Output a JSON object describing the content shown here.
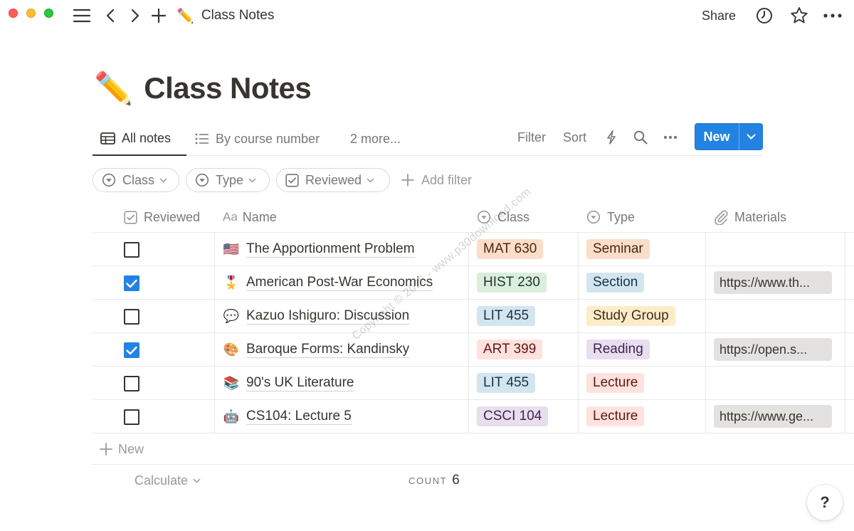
{
  "window": {
    "title_emoji": "✏️",
    "title": "Class Notes",
    "share_label": "Share"
  },
  "page": {
    "emoji": "✏️",
    "title": "Class Notes"
  },
  "views": {
    "tabs": [
      {
        "label": "All notes",
        "icon": "table-icon",
        "active": true
      },
      {
        "label": "By course number",
        "icon": "list-icon",
        "active": false
      }
    ],
    "more_label": "2 more...",
    "filter_label": "Filter",
    "sort_label": "Sort",
    "new_label": "New"
  },
  "filters": {
    "chips": [
      {
        "label": "Class",
        "icon": "select-icon"
      },
      {
        "label": "Type",
        "icon": "select-icon"
      },
      {
        "label": "Reviewed",
        "icon": "checkbox-icon"
      }
    ],
    "add_label": "Add filter"
  },
  "table": {
    "columns": [
      {
        "label": "Reviewed",
        "icon": "checkbox-icon"
      },
      {
        "label": "Name",
        "icon": "text-icon",
        "prefix": "Aa"
      },
      {
        "label": "Class",
        "icon": "select-icon"
      },
      {
        "label": "Type",
        "icon": "select-icon"
      },
      {
        "label": "Materials",
        "icon": "paperclip-icon"
      }
    ],
    "rows": [
      {
        "reviewed": false,
        "emoji": "🇺🇸",
        "name": "The Apportionment Problem",
        "class": "MAT 630",
        "type": "Seminar",
        "materials": ""
      },
      {
        "reviewed": true,
        "emoji": "🎖️",
        "name": "American Post-War Economics",
        "class": "HIST 230",
        "type": "Section",
        "materials": "https://www.th..."
      },
      {
        "reviewed": false,
        "emoji": "💬",
        "name": "Kazuo Ishiguro: Discussion",
        "class": "LIT 455",
        "type": "Study Group",
        "materials": ""
      },
      {
        "reviewed": true,
        "emoji": "🎨",
        "name": "Baroque Forms: Kandinsky",
        "class": "ART 399",
        "type": "Reading",
        "materials": "https://open.s..."
      },
      {
        "reviewed": false,
        "emoji": "📚",
        "name": "90's UK Literature",
        "class": "LIT 455",
        "type": "Lecture",
        "materials": ""
      },
      {
        "reviewed": false,
        "emoji": "🤖",
        "name": "CS104: Lecture 5",
        "class": "CSCI 104",
        "type": "Lecture",
        "materials": "https://www.ge..."
      }
    ],
    "new_row_label": "New",
    "calculate_label": "Calculate",
    "count_label": "COUNT",
    "count_value": "6"
  },
  "tag_colors": {
    "MAT 630": {
      "bg": "#fadec9",
      "fg": "#49290e"
    },
    "HIST 230": {
      "bg": "#dbeddb",
      "fg": "#1c3829"
    },
    "LIT 455": {
      "bg": "#d3e5ef",
      "fg": "#183347"
    },
    "ART 399": {
      "bg": "#ffe2dd",
      "fg": "#5d1715"
    },
    "CSCI 104": {
      "bg": "#e8deee",
      "fg": "#412454"
    },
    "Seminar": {
      "bg": "#fadec9",
      "fg": "#49290e"
    },
    "Section": {
      "bg": "#d3e5ef",
      "fg": "#183347"
    },
    "Study Group": {
      "bg": "#fdecc8",
      "fg": "#402c1b"
    },
    "Reading": {
      "bg": "#e8deee",
      "fg": "#412454"
    },
    "Lecture": {
      "bg": "#ffe2dd",
      "fg": "#5d1715"
    }
  },
  "help": {
    "label": "?"
  },
  "watermark": {
    "text": "Copyright © 2025 - www.p30download.com"
  },
  "colors": {
    "accent": "#2383e2",
    "text": "#37352f",
    "muted": "#787774"
  }
}
